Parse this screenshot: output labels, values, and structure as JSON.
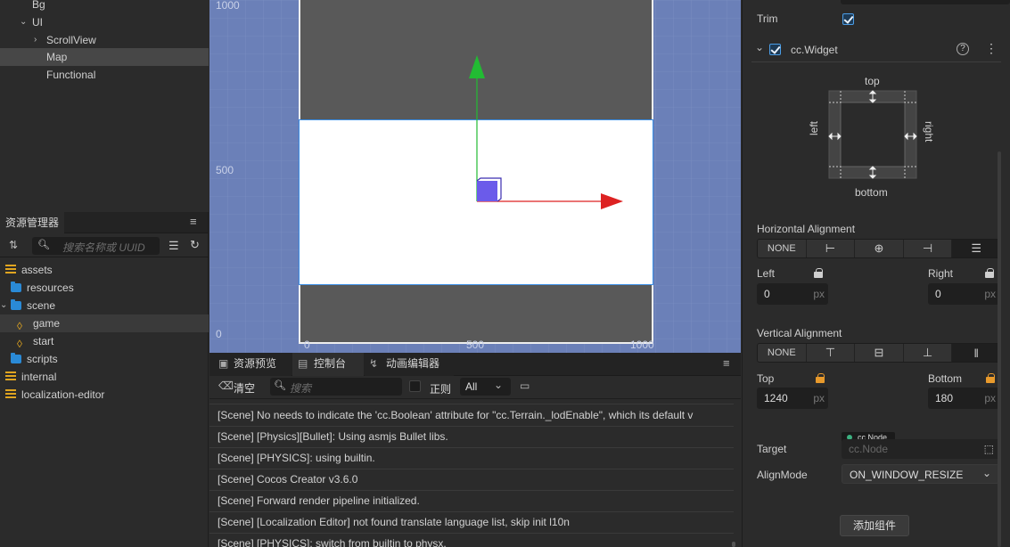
{
  "hierarchy": {
    "items": [
      {
        "label": "Bg",
        "expanded": false,
        "has_children": false
      },
      {
        "label": "UI",
        "expanded": true,
        "has_children": true
      },
      {
        "label": "ScrollView",
        "expanded": false,
        "has_children": true
      },
      {
        "label": "Map",
        "expanded": false,
        "has_children": false
      },
      {
        "label": "Functional",
        "expanded": false,
        "has_children": false
      }
    ]
  },
  "assets": {
    "tab_label": "资源管理器",
    "search_placeholder": "搜索名称或 UUID",
    "tree": [
      {
        "label": "assets",
        "icon": "assets-db-icon"
      },
      {
        "label": "resources",
        "icon": "folder-icon"
      },
      {
        "label": "scene",
        "icon": "folder-icon"
      },
      {
        "label": "game",
        "icon": "scene-file-icon"
      },
      {
        "label": "start",
        "icon": "scene-file-icon"
      },
      {
        "label": "scripts",
        "icon": "folder-icon"
      },
      {
        "label": "internal",
        "icon": "assets-db-icon"
      },
      {
        "label": "localization-editor",
        "icon": "assets-db-icon"
      }
    ]
  },
  "scene": {
    "ruler_y_top": "1000",
    "ruler_y_mid": "500",
    "ruler_y_bottom": "0",
    "ruler_x_left": "0",
    "ruler_x_mid": "500",
    "ruler_x_right": "1000"
  },
  "console": {
    "tabs": [
      {
        "label": "资源预览",
        "icon": "image-icon"
      },
      {
        "label": "控制台",
        "icon": "terminal-icon"
      },
      {
        "label": "动画编辑器",
        "icon": "animation-icon"
      }
    ],
    "clear_label": "清空",
    "search_placeholder": "搜索",
    "regex_label": "正则",
    "filter_value": "All",
    "lines": [
      "[Scene] No needs to indicate the 'cc.Boolean' attribute for \"cc.Terrain._lodEnable\", which its default v",
      "[Scene] [Physics][Bullet]: Using asmjs Bullet libs.",
      "[Scene] [PHYSICS]: using builtin.",
      "[Scene] Cocos Creator v3.6.0",
      "[Scene] Forward render pipeline initialized.",
      "[Scene] [Localization Editor] not found translate language list, skip init l10n",
      "[Scene] [PHYSICS]: switch from builtin to physx."
    ]
  },
  "inspector": {
    "trim_label": "Trim",
    "trim_checked": true,
    "component_label": "cc.Widget",
    "component_enabled": true,
    "widget_top": "top",
    "widget_bottom": "bottom",
    "widget_left": "left",
    "widget_right": "right",
    "horizontal_alignment_label": "Horizontal Alignment",
    "h_none_label": "NONE",
    "left_label": "Left",
    "right_label": "Right",
    "left_value": "0",
    "right_value": "0",
    "unit": "px",
    "vertical_alignment_label": "Vertical Alignment",
    "v_none_label": "NONE",
    "top_label": "Top",
    "bottom_label": "Bottom",
    "top_value": "1240",
    "bottom_value": "180",
    "target_label": "Target",
    "target_tag": "cc.Node",
    "target_placeholder": "cc.Node",
    "alignmode_label": "AlignMode",
    "alignmode_value": "ON_WINDOW_RESIZE",
    "add_component_label": "添加组件"
  },
  "colors": {
    "accent": "#3a8ee6",
    "lock_active": "#e89a2c",
    "gizmo_y": "#22bb33",
    "gizmo_x": "#dd2222",
    "gizmo_center": "#6b5bea"
  }
}
